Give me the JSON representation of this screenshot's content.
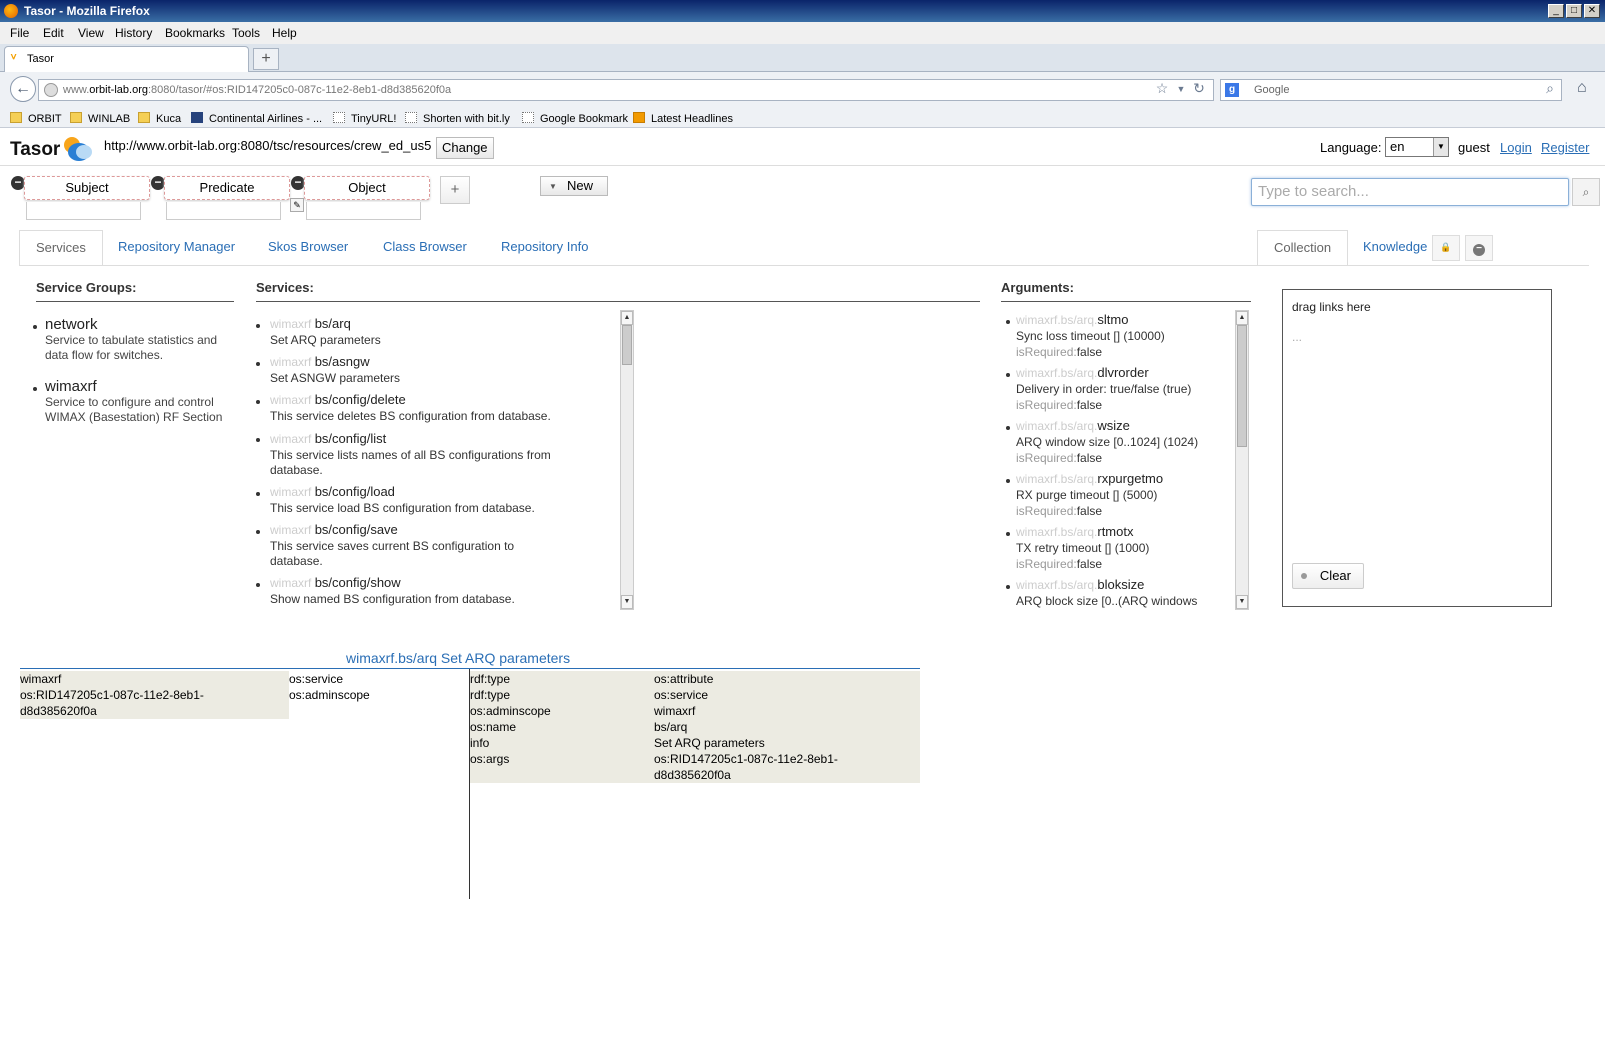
{
  "window": {
    "title": "Tasor - Mozilla Firefox"
  },
  "menu": [
    "File",
    "Edit",
    "View",
    "History",
    "Bookmarks",
    "Tools",
    "Help"
  ],
  "browser_tab": {
    "label": "Tasor"
  },
  "address": {
    "prefix": "www.",
    "host": "orbit-lab.org",
    "rest": ":8080/tasor/#os:RID147205c0-087c-11e2-8eb1-d8d385620f0a"
  },
  "search_engine": {
    "placeholder": "Google"
  },
  "bookmarks": [
    "ORBIT",
    "WINLAB",
    "Kuca",
    "Continental Airlines - ...",
    "TinyURL!",
    "Shorten with bit.ly",
    "Google Bookmark",
    "Latest Headlines"
  ],
  "header": {
    "logo": "Tasor",
    "repository_url": "http://www.orbit-lab.org:8080/tsc/resources/crew_ed_us5",
    "change_label": "Change",
    "language_label": "Language:",
    "language_value": "en",
    "user": "guest",
    "login": "Login",
    "register": "Register"
  },
  "query": {
    "subject": "Subject",
    "predicate": "Predicate",
    "object": "Object",
    "plus": "+",
    "new_label": "New",
    "search_placeholder": "Type to search..."
  },
  "tabs": [
    "Services",
    "Repository Manager",
    "Skos Browser",
    "Class Browser",
    "Repository Info"
  ],
  "right_tabs": [
    "Collection",
    "Knowledge"
  ],
  "service_groups": {
    "heading": "Service Groups:",
    "items": [
      {
        "name": "network",
        "desc": "Service to tabulate statistics and data flow for switches."
      },
      {
        "name": "wimaxrf",
        "desc": "Service to configure and control WIMAX (Basestation) RF Section"
      }
    ]
  },
  "services": {
    "heading": "Services:",
    "items": [
      {
        "prefix": "wimaxrf",
        "name": "bs/arq",
        "desc": "Set ARQ parameters"
      },
      {
        "prefix": "wimaxrf",
        "name": "bs/asngw",
        "desc": "Set ASNGW parameters"
      },
      {
        "prefix": "wimaxrf",
        "name": "bs/config/delete",
        "desc": "This service deletes BS configuration from database."
      },
      {
        "prefix": "wimaxrf",
        "name": "bs/config/list",
        "desc": "This service lists names of all BS configurations from database."
      },
      {
        "prefix": "wimaxrf",
        "name": "bs/config/load",
        "desc": "This service load BS configuration from database."
      },
      {
        "prefix": "wimaxrf",
        "name": "bs/config/save",
        "desc": "This service saves current BS configuration to database."
      },
      {
        "prefix": "wimaxrf",
        "name": "bs/config/show",
        "desc": "Show named BS configuration from database."
      }
    ]
  },
  "arguments": {
    "heading": "Arguments:",
    "items": [
      {
        "prefix": "wimaxrf.bs/arq.",
        "name": "sltmo",
        "desc": "Sync loss timeout [] (10000)",
        "req_label": "isRequired:",
        "req": "false"
      },
      {
        "prefix": "wimaxrf.bs/arq.",
        "name": "dlvrorder",
        "desc": "Delivery in order: true/false (true)",
        "req_label": "isRequired:",
        "req": "false"
      },
      {
        "prefix": "wimaxrf.bs/arq.",
        "name": "wsize",
        "desc": "ARQ window size [0..1024] (1024)",
        "req_label": "isRequired:",
        "req": "false"
      },
      {
        "prefix": "wimaxrf.bs/arq.",
        "name": "rxpurgetmo",
        "desc": "RX purge timeout [] (5000)",
        "req_label": "isRequired:",
        "req": "false"
      },
      {
        "prefix": "wimaxrf.bs/arq.",
        "name": "rtmotx",
        "desc": "TX retry timeout [] (1000)",
        "req_label": "isRequired:",
        "req": "false"
      },
      {
        "prefix": "wimaxrf.bs/arq.",
        "name": "bloksize",
        "desc": "ARQ block size [0..(ARQ windows",
        "req_label": "",
        "req": ""
      }
    ]
  },
  "collection": {
    "drop_label": "drag links here",
    "dots": "...",
    "clear_label": "Clear"
  },
  "detail": {
    "title": "wimaxrf.bs/arq Set ARQ parameters",
    "left": {
      "line1": "wimaxrf",
      "line2": "os:RID147205c1-087c-11e2-8eb1-",
      "line3": "d8d385620f0a"
    },
    "left_preds": [
      "os:service",
      "os:adminscope"
    ],
    "rows": [
      {
        "p": "rdf:type",
        "o": "os:attribute"
      },
      {
        "p": "rdf:type",
        "o": "os:service"
      },
      {
        "p": "os:adminscope",
        "o": "wimaxrf"
      },
      {
        "p": "os:name",
        "o": "bs/arq"
      },
      {
        "p": "info",
        "o": "Set ARQ parameters"
      },
      {
        "p": "os:args",
        "o": "os:RID147205c1-087c-11e2-8eb1-"
      },
      {
        "p": "",
        "o": "d8d385620f0a"
      }
    ]
  }
}
